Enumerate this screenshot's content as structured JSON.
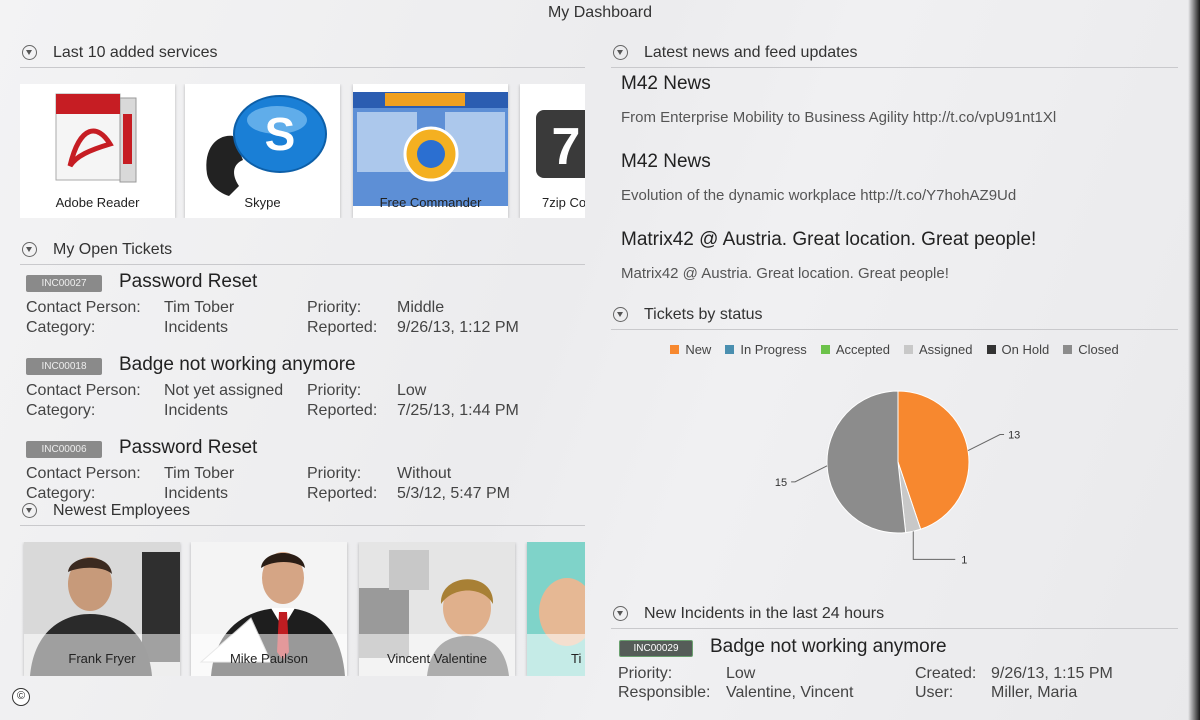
{
  "window": {
    "title": "My Dashboard"
  },
  "services": {
    "header": "Last 10 added services",
    "items": [
      {
        "label": "Adobe Reader",
        "icon": "adobe-reader-icon"
      },
      {
        "label": "Skype",
        "icon": "skype-icon"
      },
      {
        "label": "Free Commander",
        "icon": "free-commander-icon"
      },
      {
        "label": "7zip Co",
        "icon": "7zip-icon"
      }
    ]
  },
  "tickets": {
    "header": "My Open Tickets",
    "labels": {
      "contact": "Contact Person:",
      "category": "Category:",
      "priority": "Priority:",
      "reported": "Reported:"
    },
    "items": [
      {
        "id": "INC00027",
        "title": "Password Reset",
        "contact": "Tim Tober",
        "category": "Incidents",
        "priority": "Middle",
        "reported": "9/26/13, 1:12 PM"
      },
      {
        "id": "INC00018",
        "title": "Badge not working anymore",
        "contact": "Not yet assigned",
        "category": "Incidents",
        "priority": "Low",
        "reported": "7/25/13, 1:44 PM"
      },
      {
        "id": "INC00006",
        "title": "Password Reset",
        "contact": "Tim Tober",
        "category": "Incidents",
        "priority": "Without",
        "reported": "5/3/12, 5:47 PM"
      }
    ]
  },
  "employees": {
    "header": "Newest Employees",
    "items": [
      {
        "name": "Frank Fryer"
      },
      {
        "name": "Mike Paulson"
      },
      {
        "name": "Vincent Valentine"
      },
      {
        "name": "Ti"
      }
    ]
  },
  "news": {
    "header": "Latest news and feed updates",
    "items": [
      {
        "title": "M42 News",
        "body": "From Enterprise Mobility to Business Agility http://t.co/vpU91nt1Xl"
      },
      {
        "title": "M42 News",
        "body": "Evolution of the dynamic workplace http://t.co/Y7hohAZ9Ud"
      },
      {
        "title": "Matrix42 @ Austria. Great location. Great people!",
        "body": "Matrix42 @ Austria. Great location. Great people!"
      }
    ]
  },
  "status_chart": {
    "header": "Tickets by status",
    "legend": [
      {
        "label": "New",
        "color": "#f7882f"
      },
      {
        "label": "In Progress",
        "color": "#4a8fb0"
      },
      {
        "label": "Accepted",
        "color": "#6cc24a"
      },
      {
        "label": "Assigned",
        "color": "#c8c8c8"
      },
      {
        "label": "On Hold",
        "color": "#333333"
      },
      {
        "label": "Closed",
        "color": "#8c8c8c"
      }
    ]
  },
  "chart_data": {
    "type": "pie",
    "title": "",
    "slices": [
      {
        "label": "New",
        "value": 13,
        "color": "#f7882f"
      },
      {
        "label": "Assigned",
        "value": 1,
        "color": "#c8c8c8"
      },
      {
        "label": "Closed",
        "value": 15,
        "color": "#8c8c8c"
      }
    ],
    "legend_position": "top"
  },
  "new_incidents": {
    "header": "New Incidents in the last 24 hours",
    "labels": {
      "priority": "Priority:",
      "responsible": "Responsible:",
      "created": "Created:",
      "user": "User:"
    },
    "items": [
      {
        "id": "INC00029",
        "title": "Badge not working anymore",
        "priority": "Low",
        "responsible": "Valentine, Vincent",
        "created": "9/26/13, 1:15 PM",
        "user": "Miller, Maria"
      }
    ]
  },
  "footer": {
    "copyright": "©"
  }
}
